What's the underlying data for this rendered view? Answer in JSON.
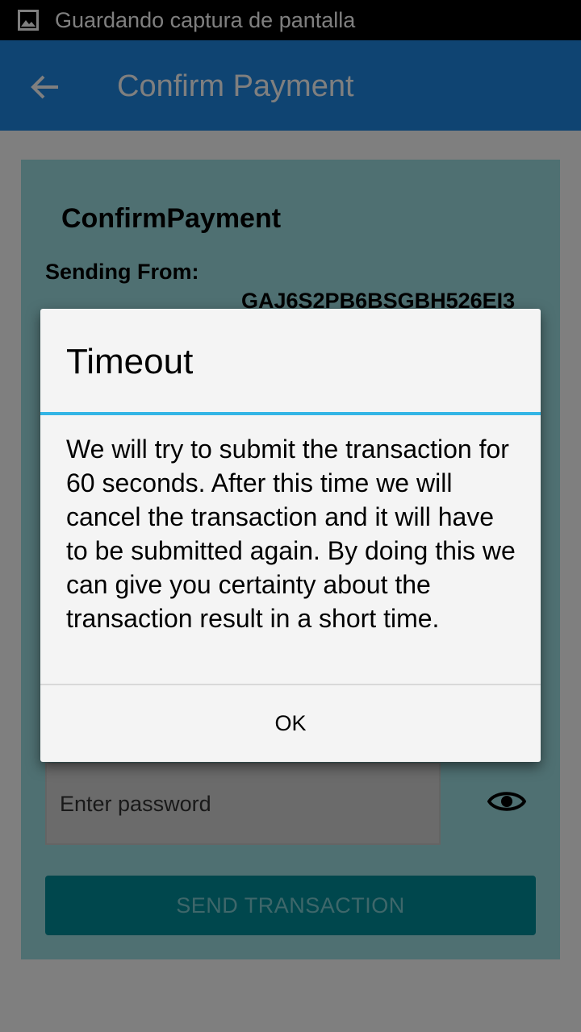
{
  "status_bar": {
    "text": "Guardando captura de pantalla",
    "icon": "image-icon"
  },
  "app_bar": {
    "title": "Confirm Payment",
    "back_icon": "arrow-back-icon",
    "color": "#1e88e5"
  },
  "card": {
    "title": "ConfirmPayment",
    "sending_from_label": "Sending From:",
    "sending_from_address": "GAJ6S2PB6BSGBH526EI3",
    "password_placeholder": "Enter password",
    "password_value": "",
    "visibility_icon": "eye-icon",
    "send_button_label": "SEND TRANSACTION"
  },
  "dialog": {
    "title": "Timeout",
    "message": "We will try to submit the transaction for 60 seconds. After this time we will cancel the transaction and it will have to be submitted again. By doing this we can give you certainty about the transaction result in a short time.",
    "ok_label": "OK",
    "accent_color": "#33b5e5"
  }
}
